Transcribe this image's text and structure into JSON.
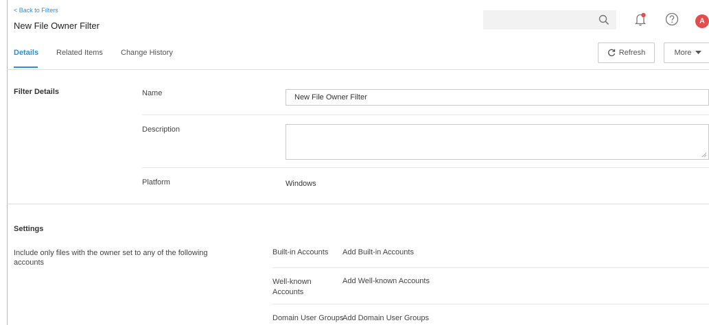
{
  "header": {
    "back_link": "< Back to Filters",
    "title": "New File Owner Filter",
    "avatar_initial": "A",
    "avatar_color": "#e64c4c",
    "accent_color": "#2b8fd6"
  },
  "tabs": [
    {
      "label": "Details",
      "active": true
    },
    {
      "label": "Related Items",
      "active": false
    },
    {
      "label": "Change History",
      "active": false
    }
  ],
  "toolbar": {
    "refresh_label": "Refresh",
    "more_label": "More"
  },
  "filter_details": {
    "section_title": "Filter Details",
    "name_label": "Name",
    "name_value": "New File Owner Filter",
    "description_label": "Description",
    "description_value": "",
    "platform_label": "Platform",
    "platform_value": "Windows"
  },
  "settings": {
    "section_title": "Settings",
    "description": "Include only files with the owner set to any of the following accounts",
    "rows": [
      {
        "label": "Built-in Accounts",
        "link": "Add Built-in Accounts"
      },
      {
        "label": "Well-known Accounts",
        "link": "Add Well-known Accounts"
      },
      {
        "label": "Domain User Groups",
        "link": "Add Domain User Groups"
      }
    ]
  }
}
